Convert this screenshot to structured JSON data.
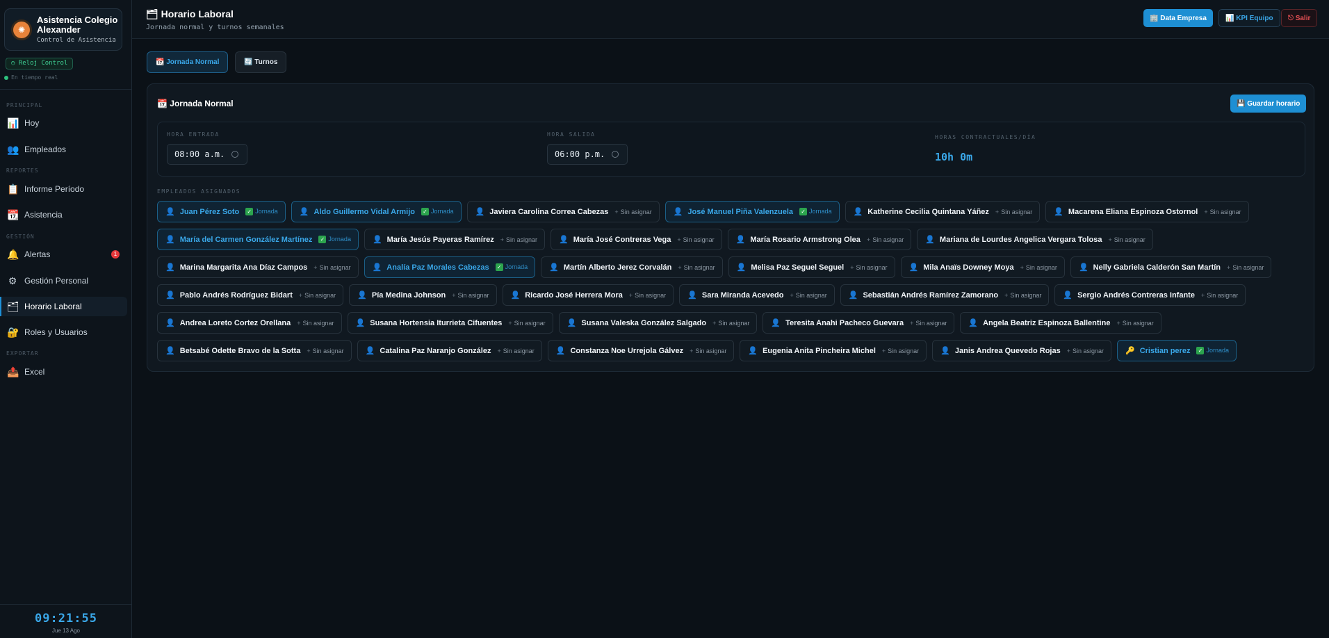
{
  "brand": {
    "title": "Asistencia Colegio Alexander",
    "subtitle": "Control de Asistencia"
  },
  "sidebar": {
    "clock_badge": "◷ Reloj Control",
    "realtime": "En tiempo real",
    "sections": {
      "principal": "PRINCIPAL",
      "reportes": "REPORTES",
      "gestion": "GESTIÓN",
      "exportar": "EXPORTAR"
    },
    "items": [
      {
        "label": "Hoy",
        "icon": "📊"
      },
      {
        "label": "Empleados",
        "icon": "👥"
      },
      {
        "label": "Informe Período",
        "icon": "📋"
      },
      {
        "label": "Asistencia",
        "icon": "📆"
      },
      {
        "label": "Alertas",
        "icon": "🔔",
        "badge": "1"
      },
      {
        "label": "Gestión Personal",
        "icon": "⚙"
      },
      {
        "label": "Horario Laboral",
        "icon": "🗂",
        "active": true
      },
      {
        "label": "Roles y Usuarios",
        "icon": "🔐"
      },
      {
        "label": "Excel",
        "icon": "📤"
      }
    ],
    "clock": "09:21:55",
    "date": "Jue 13 Ago"
  },
  "header": {
    "title": "🗂 Horario Laboral",
    "subtitle": "Jornada normal y turnos semanales",
    "btn_data": "🏢 Data Empresa",
    "btn_kpi": "📊 KPI Equipo",
    "btn_logout": "⎋ Salir"
  },
  "tabs": {
    "jornada": "📆 Jornada Normal",
    "turnos": "🔄 Turnos"
  },
  "card": {
    "title": "📆 Jornada Normal",
    "save": "💾 Guardar horario",
    "entry_label": "HORA ENTRADA",
    "entry_value": "08:00 a.m.",
    "exit_label": "HORA SALIDA",
    "exit_value": "06:00 p.m.",
    "hours_label": "HORAS CONTRACTUALES/DÍA",
    "hours_value": "10h 0m",
    "assigned_label": "EMPLEADOS ASIGNADOS"
  },
  "status": {
    "assigned": "Jornada",
    "unassigned": "Sin asignar"
  },
  "employees": [
    {
      "name": "Juan Pérez Soto",
      "assigned": true
    },
    {
      "name": "Aldo Guillermo Vidal Armijo",
      "assigned": true
    },
    {
      "name": "Javiera Carolina Correa Cabezas",
      "assigned": false
    },
    {
      "name": "José Manuel Piña Valenzuela",
      "assigned": true
    },
    {
      "name": "Katherine Cecilia Quintana Yáñez",
      "assigned": false
    },
    {
      "name": "Macarena Eliana Espinoza Ostornol",
      "assigned": false
    },
    {
      "name": "María del Carmen González Martínez",
      "assigned": true
    },
    {
      "name": "María Jesús Payeras Ramírez",
      "assigned": false
    },
    {
      "name": "María José Contreras Vega",
      "assigned": false
    },
    {
      "name": "María Rosario Armstrong Olea",
      "assigned": false
    },
    {
      "name": "Mariana de Lourdes Angelica Vergara Tolosa",
      "assigned": false
    },
    {
      "name": "Marina Margarita Ana Díaz Campos",
      "assigned": false
    },
    {
      "name": "Analía Paz Morales Cabezas",
      "assigned": true
    },
    {
      "name": "Martín Alberto Jerez Corvalán",
      "assigned": false
    },
    {
      "name": "Melisa Paz Seguel Seguel",
      "assigned": false
    },
    {
      "name": "Mila Anaïs Downey Moya",
      "assigned": false
    },
    {
      "name": "Nelly Gabriela Calderón San Martín",
      "assigned": false
    },
    {
      "name": "Pablo Andrés Rodríguez Bidart",
      "assigned": false
    },
    {
      "name": "Pía Medina Johnson",
      "assigned": false
    },
    {
      "name": "Ricardo José Herrera Mora",
      "assigned": false
    },
    {
      "name": "Sara Miranda Acevedo",
      "assigned": false
    },
    {
      "name": "Sebastián Andrés Ramírez Zamorano",
      "assigned": false
    },
    {
      "name": "Sergio Andrés Contreras Infante",
      "assigned": false
    },
    {
      "name": "Andrea Loreto Cortez Orellana",
      "assigned": false
    },
    {
      "name": "Susana Hortensia Iturrieta Cifuentes",
      "assigned": false
    },
    {
      "name": "Susana Valeska González Salgado",
      "assigned": false
    },
    {
      "name": "Teresita Anahi Pacheco Guevara",
      "assigned": false
    },
    {
      "name": "Angela Beatriz Espinoza Ballentine",
      "assigned": false
    },
    {
      "name": "Betsabé Odette Bravo de la Sotta",
      "assigned": false
    },
    {
      "name": "Catalina Paz Naranjo González",
      "assigned": false
    },
    {
      "name": "Constanza Noe Urrejola Gálvez",
      "assigned": false
    },
    {
      "name": "Eugenia Anita Pincheira Michel",
      "assigned": false
    },
    {
      "name": "Janis Andrea Quevedo Rojas",
      "assigned": false
    },
    {
      "name": "Cristian perez",
      "assigned": true,
      "icon": "🔑"
    }
  ],
  "colors": {
    "accent": "#1e8fd3",
    "success": "#2ec27e",
    "danger": "#e5383b",
    "background": "#0b1117"
  }
}
